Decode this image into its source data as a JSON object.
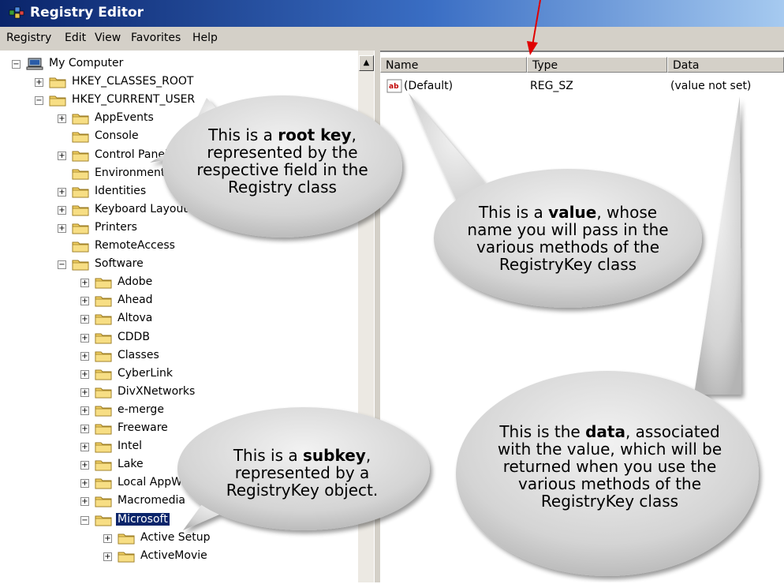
{
  "window": {
    "title": "Registry Editor"
  },
  "menu": [
    "Registry",
    "Edit",
    "View",
    "Favorites",
    "Help"
  ],
  "tree": [
    {
      "label": "My Computer",
      "depth": 0,
      "toggle": "−",
      "icon": "computer-icon"
    },
    {
      "label": "HKEY_CLASSES_ROOT",
      "depth": 1,
      "toggle": "+"
    },
    {
      "label": "HKEY_CURRENT_USER",
      "depth": 1,
      "toggle": "−"
    },
    {
      "label": "AppEvents",
      "depth": 2,
      "toggle": "+"
    },
    {
      "label": "Console",
      "depth": 2,
      "toggle": ""
    },
    {
      "label": "Control Panel",
      "depth": 2,
      "toggle": "+"
    },
    {
      "label": "Environment",
      "depth": 2,
      "toggle": ""
    },
    {
      "label": "Identities",
      "depth": 2,
      "toggle": "+"
    },
    {
      "label": "Keyboard Layout",
      "depth": 2,
      "toggle": "+"
    },
    {
      "label": "Printers",
      "depth": 2,
      "toggle": "+"
    },
    {
      "label": "RemoteAccess",
      "depth": 2,
      "toggle": ""
    },
    {
      "label": "Software",
      "depth": 2,
      "toggle": "−"
    },
    {
      "label": "Adobe",
      "depth": 3,
      "toggle": "+"
    },
    {
      "label": "Ahead",
      "depth": 3,
      "toggle": "+"
    },
    {
      "label": "Altova",
      "depth": 3,
      "toggle": "+"
    },
    {
      "label": "CDDB",
      "depth": 3,
      "toggle": "+"
    },
    {
      "label": "Classes",
      "depth": 3,
      "toggle": "+"
    },
    {
      "label": "CyberLink",
      "depth": 3,
      "toggle": "+"
    },
    {
      "label": "DivXNetworks",
      "depth": 3,
      "toggle": "+"
    },
    {
      "label": "e-merge",
      "depth": 3,
      "toggle": "+"
    },
    {
      "label": "Freeware",
      "depth": 3,
      "toggle": "+"
    },
    {
      "label": "Intel",
      "depth": 3,
      "toggle": "+"
    },
    {
      "label": "Lake",
      "depth": 3,
      "toggle": "+"
    },
    {
      "label": "Local AppWizard-Generated Applications",
      "depth": 3,
      "toggle": "+"
    },
    {
      "label": "Macromedia",
      "depth": 3,
      "toggle": "+"
    },
    {
      "label": "Microsoft",
      "depth": 3,
      "toggle": "−",
      "selected": true
    },
    {
      "label": "Active Setup",
      "depth": 4,
      "toggle": "+"
    },
    {
      "label": "ActiveMovie",
      "depth": 4,
      "toggle": "+"
    }
  ],
  "list": {
    "columns": [
      "Name",
      "Type",
      "Data"
    ],
    "rows": [
      {
        "name": "(Default)",
        "type": "REG_SZ",
        "data": "(value not set)",
        "icon": "string-value-icon"
      }
    ]
  },
  "callouts": {
    "root_key": {
      "pre": "This is a ",
      "bold": "root key",
      "post": ", represented by the respective field in the Registry class"
    },
    "value": {
      "pre": "This is a ",
      "bold": "value",
      "post": ", whose name you will pass in the various methods of the RegistryKey class"
    },
    "subkey": {
      "pre": "This is a ",
      "bold": "subkey",
      "post": ", represented by a RegistryKey object."
    },
    "data": {
      "pre": "This is the ",
      "bold": "data",
      "post": ", associated with the value, which will be returned when you use the various methods of the RegistryKey class"
    }
  },
  "colors": {
    "titlebar": "#0a246a",
    "selection": "#0a246a",
    "folder": "#f2d063",
    "bubble": "#d6d6d6",
    "arrow": "#e00000"
  }
}
